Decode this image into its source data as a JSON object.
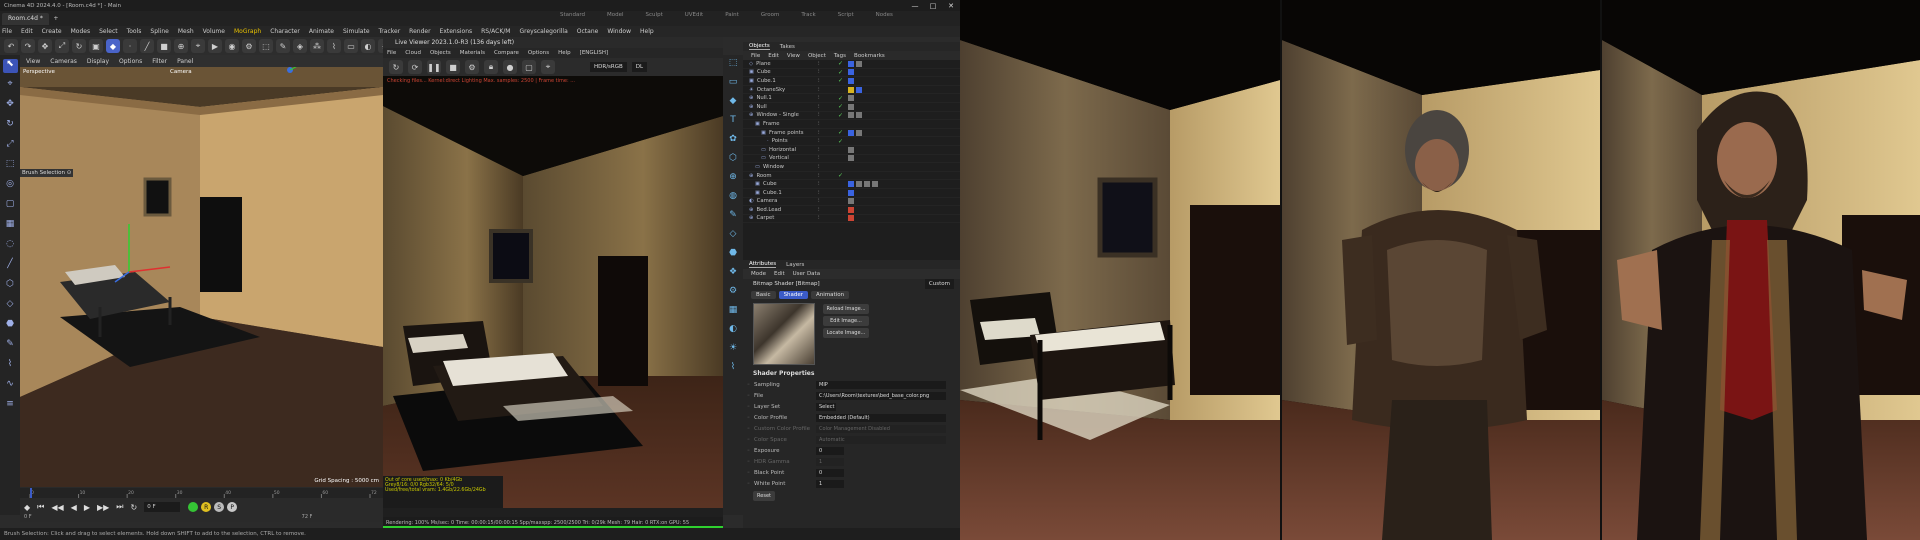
{
  "app": {
    "title": "Cinema 4D 2024.4.0 - [Room.c4d *] - Main",
    "window_buttons": [
      "—",
      "□",
      "✕"
    ],
    "tabs": [
      {
        "label": "Room.c4d *"
      }
    ],
    "tab_add": "+",
    "layouts": [
      "Standard",
      "Model",
      "Sculpt",
      "UVEdit",
      "Paint",
      "Groom",
      "Track",
      "Script",
      "Nodes"
    ]
  },
  "menubar": {
    "items": [
      "File",
      "Edit",
      "Create",
      "Modes",
      "Select",
      "Tools",
      "Spline",
      "Mesh",
      "Volume",
      "MoGraph",
      "Character",
      "Animate",
      "Simulate",
      "Tracker",
      "Render",
      "Extensions",
      "RS/ACK/M",
      "Greyscalegorilla",
      "Octane",
      "Window",
      "Help"
    ],
    "highlight": "MoGraph"
  },
  "toolbar": {
    "icons": [
      "undo-icon",
      "redo-icon",
      "move-icon",
      "scale-icon",
      "rotate-icon",
      "select-icon",
      "object-mode-icon",
      "points-icon",
      "edges-icon",
      "polygons-icon",
      "axis-icon",
      "snap-icon",
      "render-view-icon",
      "render-icon",
      "render-settings-icon",
      "cube-icon",
      "pen-icon",
      "subdivision-icon",
      "cloner-icon",
      "deformer-icon",
      "floor-icon",
      "camera-icon",
      "light-icon"
    ],
    "glyphs": [
      "↶",
      "↷",
      "✥",
      "⤢",
      "↻",
      "▣",
      "◆",
      "·",
      "╱",
      "■",
      "⊕",
      "⌖",
      "▶",
      "◉",
      "⚙",
      "⬚",
      "✎",
      "◈",
      "⁂",
      "⌇",
      "▭",
      "◐",
      "☀"
    ]
  },
  "viewport": {
    "menu": [
      "View",
      "Cameras",
      "Display",
      "Options",
      "Filter",
      "Panel"
    ],
    "label_left": "Perspective",
    "label_camera": "Camera",
    "hud_label": "Brush Selection ⊙",
    "grid_spacing": "Grid Spacing : 5000 cm"
  },
  "left_tools": {
    "glyphs": [
      "⬉",
      "⌖",
      "✥",
      "↻",
      "⤢",
      "⬚",
      "◎",
      "▢",
      "▦",
      "◌",
      "╱",
      "⬡",
      "◇",
      "⬣",
      "✎",
      "⌇",
      "∿",
      "≡"
    ]
  },
  "timeline": {
    "glyphs": [
      "◆",
      "⏮",
      "◀◀",
      "◀",
      "▶",
      "▶▶",
      "⏭",
      "↻"
    ],
    "frame_value": "0 F",
    "circles": [
      {
        "color": "#35c435",
        "label": ""
      },
      {
        "color": "#e0c020",
        "label": "R"
      },
      {
        "color": "#bbbbbb",
        "label": "S"
      },
      {
        "color": "#c8c8c8",
        "label": "P"
      }
    ],
    "start": "0 F",
    "end": "72 F",
    "ticks": [
      "0",
      "10",
      "20",
      "30",
      "40",
      "50",
      "60",
      "72"
    ]
  },
  "live_viewer": {
    "title": "Live Viewer 2023.1.0-R3 (136 days left)",
    "menu": [
      "File",
      "Cloud",
      "Objects",
      "Materials",
      "Compare",
      "Options",
      "Help",
      "[ENGLISH]"
    ],
    "mode": "HDR/sRGB",
    "mode2": "DL",
    "info": "Checking files... Kernel:direct Lighting Max. samples: 2500 | Frame time: ...",
    "status_left": "Out of core used/max: 0 Kb/4Gb",
    "status_mid": "Grey8/16: 0/0    Rgb32/64: 5/0",
    "status_mid2": "Used/free/total vram: 1.4Gb/22.6Gb/24Gb",
    "progress": "Rendering: 100%   Ms/sec: 0   Time: 00:00:15/00:00:15   Spp/maxspp: 2500/2500   Tri: 0/29k   Mesh: 79   Hair: 0   RTX:on   GPU: 55"
  },
  "objects": {
    "tabs": [
      "Objects",
      "Takes"
    ],
    "menu": [
      "File",
      "Edit",
      "View",
      "Object",
      "Tags",
      "Bookmarks"
    ],
    "rows": [
      {
        "name": "Plane",
        "icon": "◇",
        "indent": 0,
        "check": "✓",
        "tags": [
          "b",
          "g"
        ]
      },
      {
        "name": "Cube",
        "icon": "▣",
        "indent": 0,
        "check": "✓",
        "tags": [
          "b"
        ]
      },
      {
        "name": "Cube.1",
        "icon": "▣",
        "indent": 0,
        "check": "✓",
        "tags": [
          "b"
        ]
      },
      {
        "name": "OctaneSky",
        "icon": "☀",
        "indent": 0,
        "check": "",
        "tags": [
          "y",
          "b"
        ]
      },
      {
        "name": "Null.1",
        "icon": "⊕",
        "indent": 0,
        "check": "✓",
        "tags": [
          "g"
        ]
      },
      {
        "name": "Null",
        "icon": "⊕",
        "indent": 0,
        "check": "✓",
        "tags": [
          "g"
        ]
      },
      {
        "name": "Window - Single",
        "icon": "⊕",
        "indent": 0,
        "check": "✓",
        "tags": [
          "g",
          "g"
        ]
      },
      {
        "name": "Frame",
        "icon": "▣",
        "indent": 1,
        "check": "",
        "tags": []
      },
      {
        "name": "Frame points",
        "icon": "▣",
        "indent": 2,
        "check": "✓",
        "tags": [
          "b",
          "g"
        ]
      },
      {
        "name": "Points",
        "icon": "·",
        "indent": 3,
        "check": "✓",
        "tags": []
      },
      {
        "name": "Horizontal",
        "icon": "▭",
        "indent": 2,
        "check": "",
        "tags": [
          "g"
        ]
      },
      {
        "name": "Vertical",
        "icon": "▭",
        "indent": 2,
        "check": "",
        "tags": [
          "g"
        ]
      },
      {
        "name": "Window",
        "icon": "▭",
        "indent": 1,
        "check": "",
        "tags": []
      },
      {
        "name": "Room",
        "icon": "⊕",
        "indent": 0,
        "check": "✓",
        "tags": []
      },
      {
        "name": "Cube",
        "icon": "▣",
        "indent": 1,
        "check": "",
        "tags": [
          "b",
          "g",
          "g",
          "g"
        ]
      },
      {
        "name": "Cube.1",
        "icon": "▣",
        "indent": 1,
        "check": "",
        "tags": [
          "b"
        ]
      },
      {
        "name": "Camera",
        "icon": "◐",
        "indent": 0,
        "check": "",
        "tags": [
          "g"
        ]
      },
      {
        "name": "Bed.Lead",
        "icon": "⊕",
        "indent": 0,
        "check": "",
        "tags": [
          "r"
        ]
      },
      {
        "name": "Carpet",
        "icon": "⊕",
        "indent": 0,
        "check": "",
        "tags": [
          "r"
        ]
      }
    ]
  },
  "attributes": {
    "tabs": [
      "Attributes",
      "Layers"
    ],
    "menu": [
      "Mode",
      "Edit",
      "User Data"
    ],
    "header": "Bitmap Shader [Bitmap]",
    "custom": "Custom",
    "subtabs": [
      "Basic",
      "Shader",
      "Animation"
    ],
    "active_subtab": "Shader",
    "buttons": [
      "Reload Image...",
      "Edit Image...",
      "Locate Image..."
    ],
    "section": "Shader Properties",
    "props": [
      {
        "label": "Sampling",
        "value": "MIP",
        "dim": false
      },
      {
        "label": "File",
        "value": "C:\\Users\\Room\\textures\\bed_base_color.png",
        "dim": false
      },
      {
        "label": "Layer Set",
        "value": "Select",
        "dim": false
      },
      {
        "label": "Color Profile",
        "value": "Embedded (Default)",
        "dim": false
      },
      {
        "label": "Custom Color Profile",
        "value": "Color Management Disabled",
        "dim": true
      },
      {
        "label": "Color Space",
        "value": "Automatic",
        "dim": true
      },
      {
        "label": "Exposure",
        "value": "0",
        "dim": false
      },
      {
        "label": "HDR Gamma",
        "value": "1",
        "dim": true
      },
      {
        "label": "Black Point",
        "value": "0",
        "dim": false
      },
      {
        "label": "White Point",
        "value": "1",
        "dim": false
      }
    ],
    "reset": "Reset"
  },
  "statusbar": {
    "text": "Brush Selection: Click and drag to select elements. Hold down SHIFT to add to the selection, CTRL to remove."
  },
  "colors": {
    "accent": "#3b5bc7",
    "highlight": "#e7c000",
    "check": "#5bd45b",
    "warning": "#c43"
  }
}
